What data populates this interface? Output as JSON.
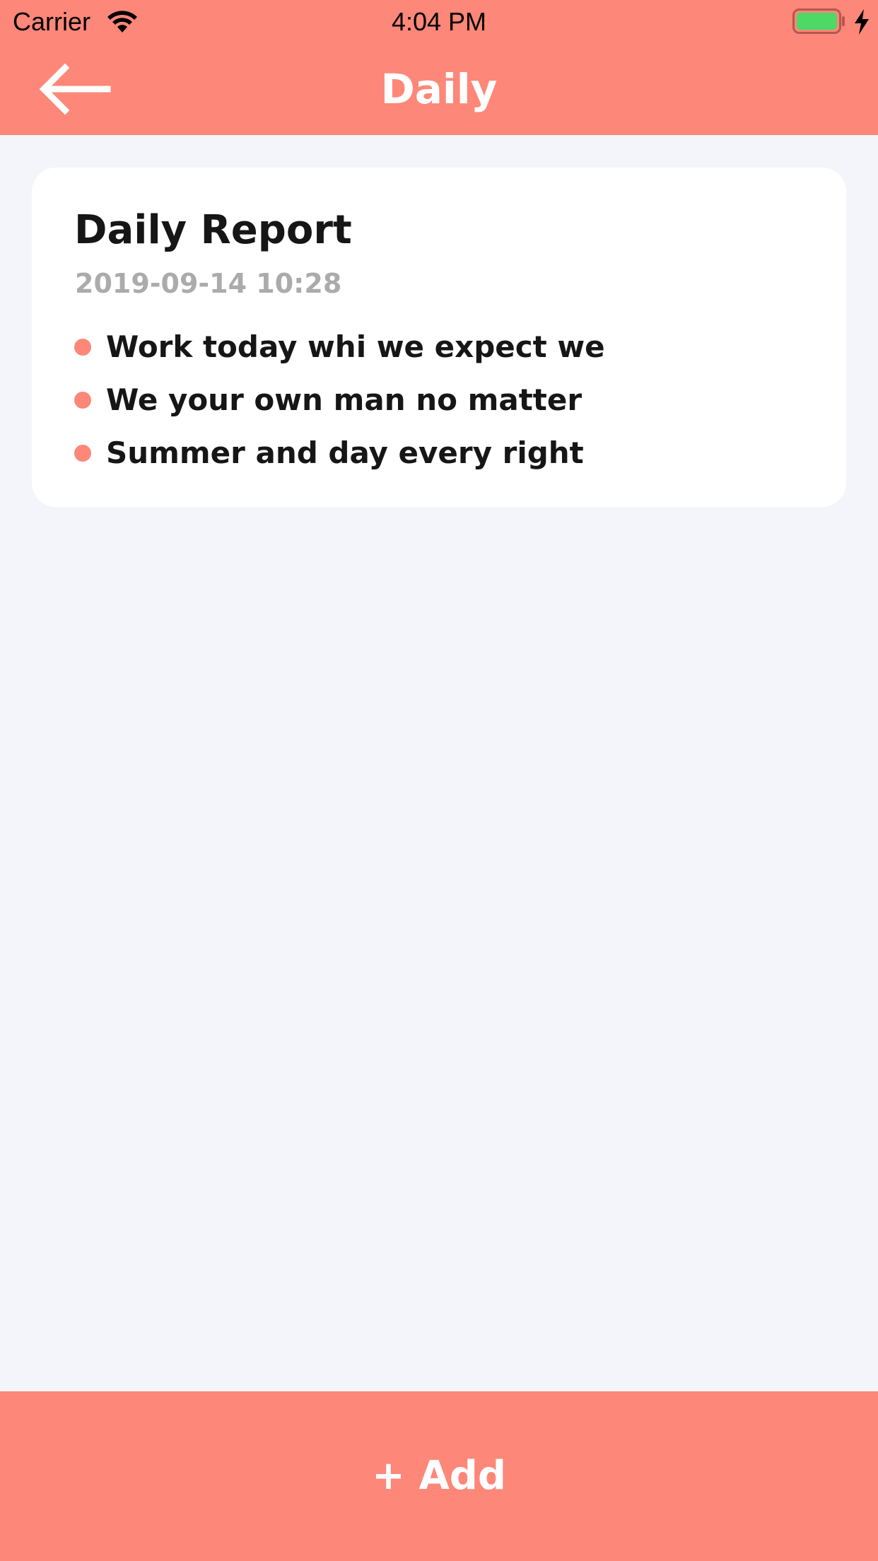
{
  "status_bar": {
    "carrier": "Carrier",
    "time": "4:04 PM",
    "wifi_icon": "wifi-icon",
    "battery_icon": "battery-icon",
    "charging_icon": "charging-bolt-icon",
    "battery_level": 1.0
  },
  "nav": {
    "back_icon": "arrow-left-icon",
    "title": "Daily"
  },
  "report": {
    "title": "Daily Report",
    "date": "2019-09-14 10:28",
    "items": [
      {
        "text": "Work today whi we expect we"
      },
      {
        "text": "We your own man no matter"
      },
      {
        "text": "Summer and day every right"
      }
    ]
  },
  "footer": {
    "add_label": "+ Add"
  },
  "colors": {
    "accent": "#fd8778",
    "background": "#f3f5fa",
    "card": "#ffffff",
    "title_text": "#161616",
    "date_text": "#ababab",
    "battery_fill": "#4cd964"
  }
}
